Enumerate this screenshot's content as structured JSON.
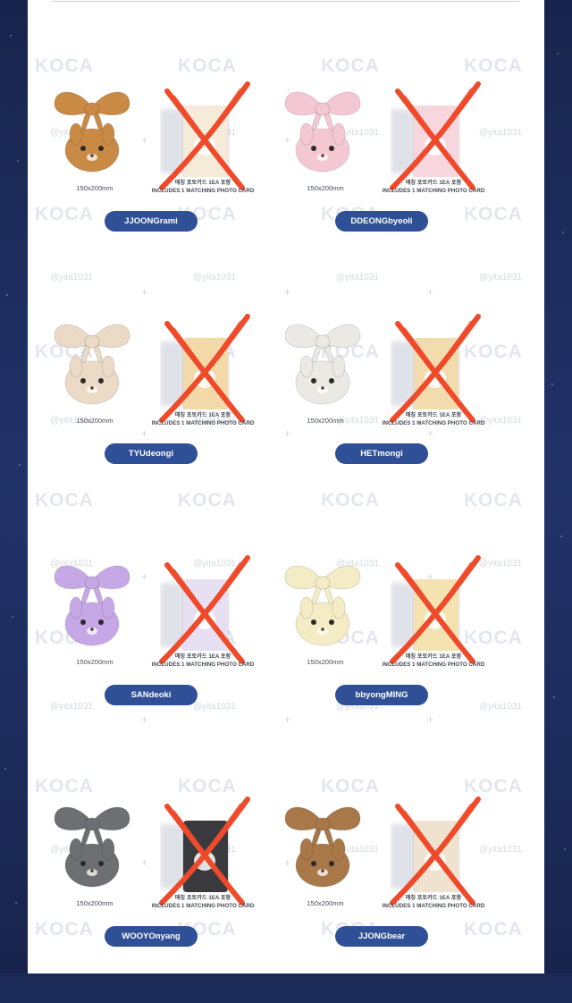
{
  "watermark": {
    "brand": "KOCA",
    "handle": "@yita1031"
  },
  "products": [
    {
      "name": "JJOONGrami",
      "size": "150x200mm",
      "includes_ko": "매칭 포토카드 1EA 포함",
      "includes_en": "INCLUDES 1 MATCHING PHOTO CARD",
      "plush_color": "#c98a45",
      "card_color": "#f6ead8",
      "marked_out": true
    },
    {
      "name": "DDEONGbyeoli",
      "size": "150x200mm",
      "includes_ko": "매칭 포토카드 1EA 포함",
      "includes_en": "INCLUDES 1 MATCHING PHOTO CARD",
      "plush_color": "#f4c8d2",
      "card_color": "#f7d6de",
      "marked_out": true
    },
    {
      "name": "TYUdeongi",
      "size": "150x200mm",
      "includes_ko": "매칭 포토카드 1EA 포함",
      "includes_en": "INCLUDES 1 MATCHING PHOTO CARD",
      "plush_color": "#eadac6",
      "card_color": "#f3d9a8",
      "marked_out": true
    },
    {
      "name": "HETmongi",
      "size": "150x200mm",
      "includes_ko": "매칭 포토카드 1EA 포함",
      "includes_en": "INCLUDES 1 MATCHING PHOTO CARD",
      "plush_color": "#ebe9e4",
      "card_color": "#f2dcae",
      "marked_out": true
    },
    {
      "name": "SANdeoki",
      "size": "150x200mm",
      "includes_ko": "매칭 포토카드 1EA 포함",
      "includes_en": "INCLUDES 1 MATCHING PHOTO CARD",
      "plush_color": "#c6a8e6",
      "card_color": "#e7e0f2",
      "marked_out": true
    },
    {
      "name": "bbyongMING",
      "size": "150x200mm",
      "includes_ko": "매칭 포토카드 1EA 포함",
      "includes_en": "INCLUDES 1 MATCHING PHOTO CARD",
      "plush_color": "#f4ecc4",
      "card_color": "#f4e2b0",
      "marked_out": true
    },
    {
      "name": "WOOYOnyang",
      "size": "150x200mm",
      "includes_ko": "매칭 포토카드 1EA 포함",
      "includes_en": "INCLUDES 1 MATCHING PHOTO CARD",
      "plush_color": "#6d6f72",
      "card_color": "#3a3a3e",
      "marked_out": true
    },
    {
      "name": "JJONGbear",
      "size": "150x200mm",
      "includes_ko": "매칭 포토카드 1EA 포함",
      "includes_en": "INCLUDES 1 MATCHING PHOTO CARD",
      "plush_color": "#a87848",
      "card_color": "#efe2cf",
      "marked_out": true
    }
  ]
}
